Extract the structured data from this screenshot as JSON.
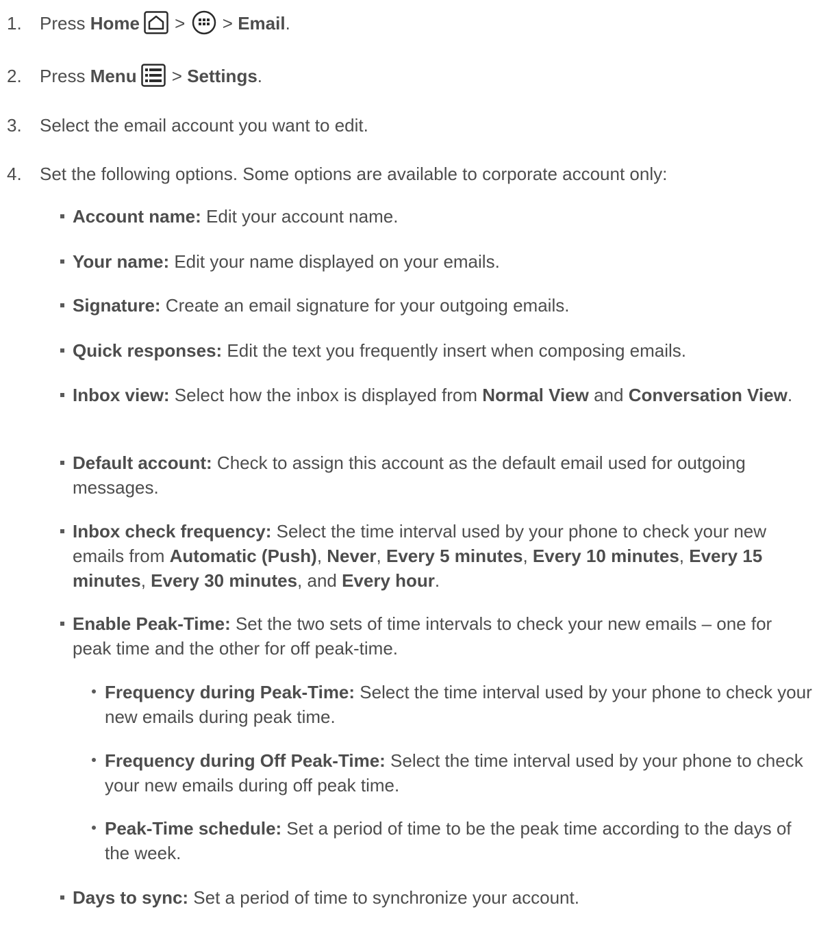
{
  "steps": [
    {
      "num": "1.",
      "press": "Press ",
      "home": "Home",
      "sep1": " > ",
      "sep2": " > ",
      "email": "Email",
      "end": "."
    },
    {
      "num": "2.",
      "press": "Press ",
      "menu": "Menu",
      "sep1": " > ",
      "settings": "Settings",
      "end": "."
    },
    {
      "num": "3.",
      "text": "Select the email account you want to edit."
    },
    {
      "num": "4.",
      "text": "Set the following options. Some options are available to corporate account only:"
    }
  ],
  "icons": {
    "home": "home-icon",
    "apps": "apps-icon",
    "menu": "menu-icon"
  },
  "options": [
    {
      "label": "Account name:",
      "text": " Edit your account name."
    },
    {
      "label": "Your name:",
      "text": " Edit your name displayed on your emails."
    },
    {
      "label": "Signature:",
      "text": " Create an email signature for your outgoing emails."
    },
    {
      "label": "Quick responses:",
      "text": " Edit the text you frequently insert when composing emails."
    },
    {
      "label": "Inbox view:",
      "text": " Select how the inbox is displayed from ",
      "b1": "Normal View",
      "t2": " and ",
      "b2": "Conversation View",
      "t3": "."
    },
    {
      "label": "Default account:",
      "text": " Check to assign this account as the default email used for outgoing messages."
    },
    {
      "label": "Inbox check frequency:",
      "text": " Select the time interval used by your phone to check your new emails from ",
      "f1": "Automatic (Push)",
      "c1": ", ",
      "f2": "Never",
      "c2": ", ",
      "f3": "Every 5 minutes",
      "c3": ", ",
      "f4": "Every 10 minutes",
      "c4": ", ",
      "f5": "Every 15 minutes",
      "c5": ", ",
      "f6": "Every 30 minutes",
      "c6": ", and ",
      "f7": "Every hour",
      "c7": "."
    },
    {
      "label": "Enable Peak-Time:",
      "text": " Set the two sets of time intervals to check your new emails – one for peak time and the other for off peak-time."
    },
    {
      "label": "Days to sync:",
      "text": " Set a period of time to synchronize your account."
    }
  ],
  "peak_options": [
    {
      "label": "Frequency during Peak-Time:",
      "text": " Select the time interval used by your phone to check your new emails during peak time."
    },
    {
      "label": "Frequency during Off Peak-Time:",
      "text": " Select the time interval used by your phone to check your new emails during off peak time."
    },
    {
      "label": "Peak-Time schedule:",
      "text": " Set a period of time to be the peak time according to the days of the week."
    }
  ]
}
